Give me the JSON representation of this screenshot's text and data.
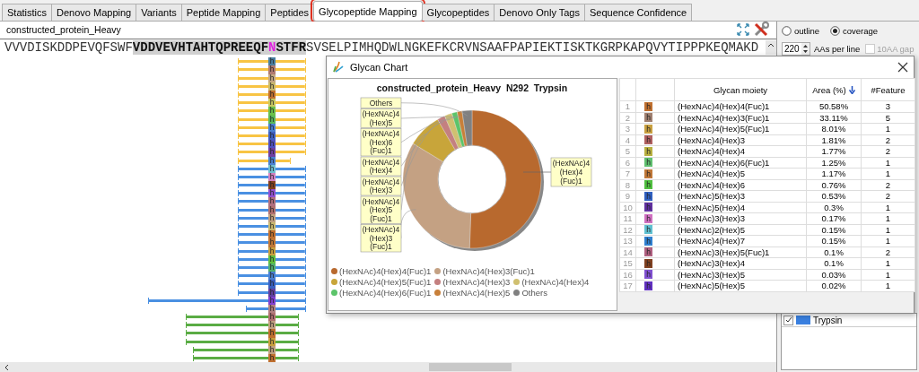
{
  "tabs": [
    {
      "label": "Statistics",
      "selected": false,
      "highlighted": false
    },
    {
      "label": "Denovo Mapping",
      "selected": false,
      "highlighted": false
    },
    {
      "label": "Variants",
      "selected": false,
      "highlighted": false
    },
    {
      "label": "Peptide Mapping",
      "selected": false,
      "highlighted": false
    },
    {
      "label": "Peptides",
      "selected": false,
      "highlighted": false
    },
    {
      "label": "Glycopeptide Mapping",
      "selected": true,
      "highlighted": true
    },
    {
      "label": "Glycopeptides",
      "selected": false,
      "highlighted": false
    },
    {
      "label": "Denovo Only Tags",
      "selected": false,
      "highlighted": false
    },
    {
      "label": "Sequence Confidence",
      "selected": false,
      "highlighted": false
    }
  ],
  "protein": {
    "name": "constructed_protein_Heavy"
  },
  "sequence": {
    "before": "VVVDISKDDPEVQFSWF",
    "peptide_start": "VDDVEVHTAHTQPREEQF",
    "site": "N",
    "peptide_end": "STFR",
    "after": "SVSELPIMHQDWLNGKEFKCRVNSAAFPAPIEKTISKTKGRPKAPQVYTIPPPKEQMAKD"
  },
  "peptides": [
    {
      "kind": "full",
      "color": "#f8c444",
      "glycan": {
        "label": "h",
        "color": "#4a7fa0"
      }
    },
    {
      "kind": "full",
      "color": "#f8c444",
      "glycan": {
        "label": "h",
        "color": "#b07a70"
      }
    },
    {
      "kind": "full",
      "color": "#f8c444",
      "glycan": {
        "label": "h",
        "color": "#c4a882"
      }
    },
    {
      "kind": "full",
      "color": "#f8c444",
      "glycan": {
        "label": "h",
        "color": "#c8b86a"
      }
    },
    {
      "kind": "full",
      "color": "#f8c444",
      "glycan": {
        "label": "h",
        "color": "#c07030"
      }
    },
    {
      "kind": "full",
      "color": "#f8c444",
      "glycan": {
        "label": "h",
        "color": "#c8c860"
      }
    },
    {
      "kind": "full",
      "color": "#f8c444",
      "glycan": {
        "label": "h",
        "color": "#6cc04a"
      }
    },
    {
      "kind": "full",
      "color": "#f8c444",
      "glycan": {
        "label": "h",
        "color": "#5ab85a"
      }
    },
    {
      "kind": "full",
      "color": "#f8c444",
      "glycan": {
        "label": "h",
        "color": "#4a7fd0"
      }
    },
    {
      "kind": "full",
      "color": "#f8c444",
      "glycan": {
        "label": "h",
        "color": "#4060c0"
      }
    },
    {
      "kind": "full",
      "color": "#f8c444",
      "glycan": {
        "label": "h",
        "color": "#5050c0"
      }
    },
    {
      "kind": "full",
      "color": "#f8c444",
      "glycan": {
        "label": "h",
        "color": "#7040a0"
      }
    },
    {
      "kind": "short",
      "color": "#f8c444",
      "glycan": {
        "label": "h",
        "color": "#4a80d0"
      }
    },
    {
      "kind": "full",
      "color": "#4a90e2",
      "glycan": {
        "label": "h",
        "color": "#70c0d0"
      }
    },
    {
      "kind": "full",
      "color": "#4a90e2",
      "glycan": {
        "label": "h",
        "color": "#d080c0"
      }
    },
    {
      "kind": "full",
      "color": "#4a90e2",
      "glycan": {
        "label": "h",
        "color": "#804020"
      }
    },
    {
      "kind": "full",
      "color": "#4a90e2",
      "glycan": {
        "label": "h",
        "color": "#9050d0"
      }
    },
    {
      "kind": "full",
      "color": "#4a90e2",
      "glycan": {
        "label": "h",
        "color": "#b07080"
      }
    },
    {
      "kind": "full",
      "color": "#4a90e2",
      "glycan": {
        "label": "h",
        "color": "#b07070"
      }
    },
    {
      "kind": "full",
      "color": "#4a90e2",
      "glycan": {
        "label": "h",
        "color": "#c0a080"
      }
    },
    {
      "kind": "full",
      "color": "#4a90e2",
      "glycan": {
        "label": "h",
        "color": "#c8b870"
      }
    },
    {
      "kind": "full",
      "color": "#4a90e2",
      "glycan": {
        "label": "h",
        "color": "#c07030"
      }
    },
    {
      "kind": "full",
      "color": "#4a90e2",
      "glycan": {
        "label": "h",
        "color": "#c07838"
      }
    },
    {
      "kind": "full",
      "color": "#4a90e2",
      "glycan": {
        "label": "h",
        "color": "#c8a040"
      }
    },
    {
      "kind": "full",
      "color": "#4a90e2",
      "glycan": {
        "label": "h",
        "color": "#60c040"
      }
    },
    {
      "kind": "full",
      "color": "#4a90e2",
      "glycan": {
        "label": "h",
        "color": "#50b070"
      }
    },
    {
      "kind": "full",
      "color": "#4a90e2",
      "glycan": {
        "label": "h",
        "color": "#4a80d0"
      }
    },
    {
      "kind": "full",
      "color": "#4a90e2",
      "glycan": {
        "label": "h",
        "color": "#3a60c0"
      }
    },
    {
      "kind": "full",
      "color": "#4a90e2",
      "glycan": {
        "label": "h",
        "color": "#6040a0"
      }
    },
    {
      "kind": "long",
      "color": "#4a90e2",
      "glycan": {
        "label": "h",
        "color": "#8040d0"
      }
    },
    {
      "kind": "late",
      "color": "#4a90e2",
      "glycan": {
        "label": "h",
        "color": "#b08080"
      }
    },
    {
      "kind": "early",
      "color": "#5aac44",
      "glycan": {
        "label": "h",
        "color": "#b07070"
      }
    },
    {
      "kind": "early",
      "color": "#5aac44",
      "glycan": {
        "label": "h",
        "color": "#c0a080"
      }
    },
    {
      "kind": "early",
      "color": "#5aac44",
      "glycan": {
        "label": "h",
        "color": "#c07030"
      }
    },
    {
      "kind": "early",
      "color": "#5aac44",
      "glycan": {
        "label": "h",
        "color": "#c8a040"
      }
    },
    {
      "kind": "middle",
      "color": "#5aac44",
      "glycan": {
        "label": "h",
        "color": "#c0a080"
      }
    },
    {
      "kind": "middle",
      "color": "#5aac44",
      "glycan": {
        "label": "h",
        "color": "#c07030"
      }
    }
  ],
  "options": {
    "radios": [
      {
        "label": "outline",
        "selected": false
      },
      {
        "label": "coverage",
        "selected": true
      }
    ],
    "aas_per_line": {
      "value": "220",
      "label": "AAs per line"
    },
    "gap": {
      "label": "10AA gap",
      "checked": false,
      "disabled": true
    }
  },
  "enzymes": [
    {
      "label": "Trypsin",
      "checked": true,
      "color": "#3a80e0"
    }
  ],
  "glycan_chart": {
    "title": "Glycan Chart",
    "chart_data": {
      "type": "donut",
      "title": "constructed_protein_Heavy  N292  Trypsin",
      "categories": [
        "(HexNAc)4(Hex)4(Fuc)1",
        "(HexNAc)4(Hex)3(Fuc)1",
        "(HexNAc)4(Hex)5(Fuc)1",
        "(HexNAc)4(Hex)3",
        "(HexNAc)4(Hex)4",
        "(HexNAc)4(Hex)6(Fuc)1",
        "(HexNAc)4(Hex)5",
        "Others"
      ],
      "values": [
        50.58,
        33.11,
        8.01,
        1.81,
        1.77,
        1.25,
        1.17,
        2.31
      ],
      "colors": [
        "#b8692e",
        "#c4a183",
        "#c8a53a",
        "#c48080",
        "#d0c070",
        "#5cc46a",
        "#c8803a",
        "#808080"
      ]
    },
    "legend": [
      {
        "label": "(HexNAc)4(Hex)4(Fuc)1",
        "color": "#b8692e"
      },
      {
        "label": "(HexNAc)4(Hex)3(Fuc)1",
        "color": "#c4a183"
      },
      {
        "label": "(HexNAc)4(Hex)5(Fuc)1",
        "color": "#c8a53a"
      },
      {
        "label": "(HexNAc)4(Hex)3",
        "color": "#c48080"
      },
      {
        "label": "(HexNAc)4(Hex)4",
        "color": "#d0c070"
      },
      {
        "label": "(HexNAc)4(Hex)6(Fuc)1",
        "color": "#5cc46a"
      },
      {
        "label": "(HexNAc)4(Hex)5",
        "color": "#c8803a"
      },
      {
        "label": "Others",
        "color": "#808080"
      }
    ]
  },
  "glycan_table": {
    "columns": [
      "Glycan moiety",
      "Area (%)",
      "#Feature"
    ],
    "rows": [
      {
        "index": "1",
        "color": "#c07030",
        "icon": "h",
        "moiety": "(HexNAc)4(Hex)4(Fuc)1",
        "area": "50.58%",
        "features": "3"
      },
      {
        "index": "2",
        "color": "#a08070",
        "icon": "h",
        "moiety": "(HexNAc)4(Hex)3(Fuc)1",
        "area": "33.11%",
        "features": "5"
      },
      {
        "index": "3",
        "color": "#c8a040",
        "icon": "h",
        "moiety": "(HexNAc)4(Hex)5(Fuc)1",
        "area": "8.01%",
        "features": "1"
      },
      {
        "index": "4",
        "color": "#b06060",
        "icon": "h",
        "moiety": "(HexNAc)4(Hex)3",
        "area": "1.81%",
        "features": "2"
      },
      {
        "index": "5",
        "color": "#b8b040",
        "icon": "h",
        "moiety": "(HexNAc)4(Hex)4",
        "area": "1.77%",
        "features": "2"
      },
      {
        "index": "6",
        "color": "#60c070",
        "icon": "h",
        "moiety": "(HexNAc)4(Hex)6(Fuc)1",
        "area": "1.25%",
        "features": "1"
      },
      {
        "index": "7",
        "color": "#c07838",
        "icon": "h",
        "moiety": "(HexNAc)4(Hex)5",
        "area": "1.17%",
        "features": "1"
      },
      {
        "index": "8",
        "color": "#50c040",
        "icon": "h",
        "moiety": "(HexNAc)4(Hex)6",
        "area": "0.76%",
        "features": "2"
      },
      {
        "index": "9",
        "color": "#3060c0",
        "icon": "h",
        "moiety": "(HexNAc)5(Hex)3",
        "area": "0.53%",
        "features": "2"
      },
      {
        "index": "10",
        "color": "#6030a0",
        "icon": "h",
        "moiety": "(HexNAc)5(Hex)4",
        "area": "0.3%",
        "features": "1"
      },
      {
        "index": "11",
        "color": "#d070c0",
        "icon": "h",
        "moiety": "(HexNAc)3(Hex)3",
        "area": "0.17%",
        "features": "1"
      },
      {
        "index": "12",
        "color": "#60c0d0",
        "icon": "h",
        "moiety": "(HexNAc)2(Hex)5",
        "area": "0.15%",
        "features": "1"
      },
      {
        "index": "13",
        "color": "#3080d0",
        "icon": "h",
        "moiety": "(HexNAc)4(Hex)7",
        "area": "0.15%",
        "features": "1"
      },
      {
        "index": "14",
        "color": "#b06080",
        "icon": "h",
        "moiety": "(HexNAc)3(Hex)5(Fuc)1",
        "area": "0.1%",
        "features": "2"
      },
      {
        "index": "15",
        "color": "#804020",
        "icon": "h",
        "moiety": "(HexNAc)3(Hex)4",
        "area": "0.1%",
        "features": "1"
      },
      {
        "index": "16",
        "color": "#8050d0",
        "icon": "h",
        "moiety": "(HexNAc)3(Hex)5",
        "area": "0.03%",
        "features": "1"
      },
      {
        "index": "17",
        "color": "#6030c0",
        "icon": "h",
        "moiety": "(HexNAc)5(Hex)5",
        "area": "0.02%",
        "features": "1"
      }
    ]
  }
}
